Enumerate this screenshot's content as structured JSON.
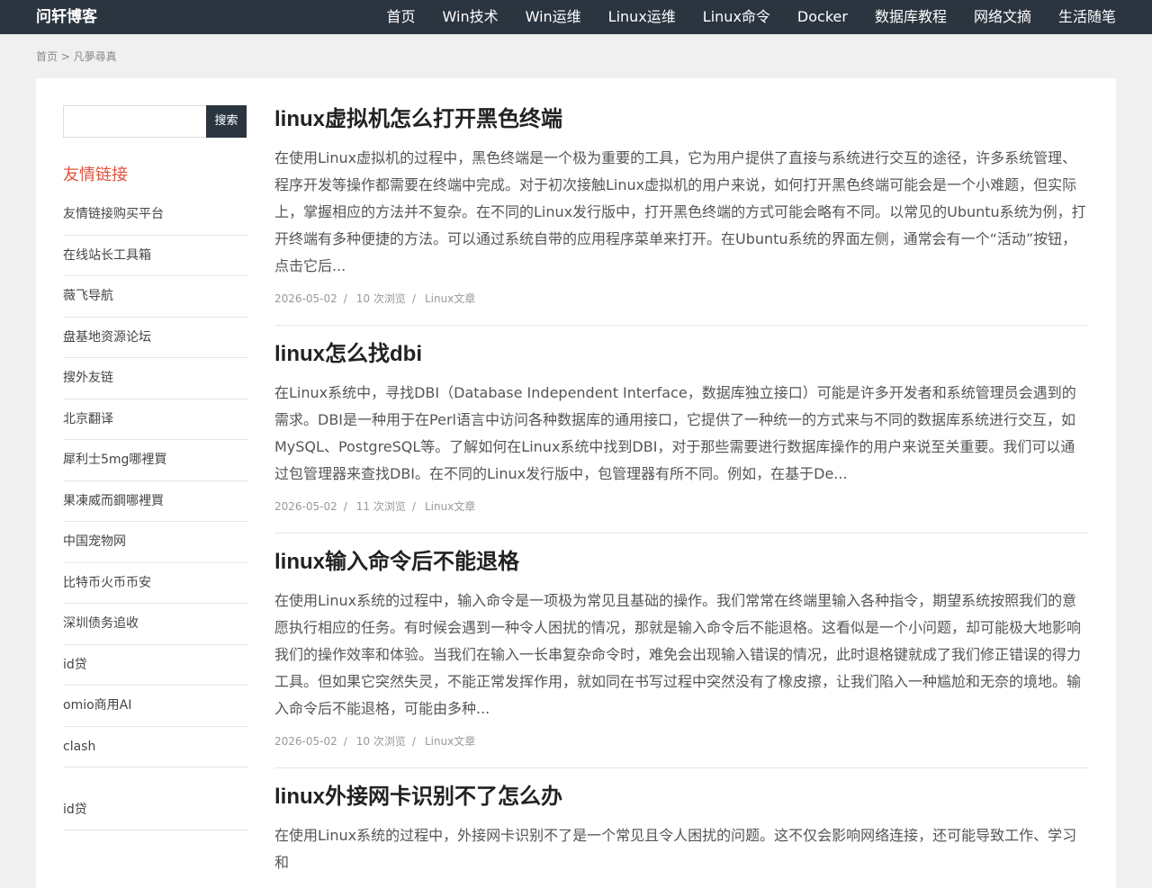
{
  "header": {
    "brand": "问轩博客",
    "nav": [
      "首页",
      "Win技术",
      "Win运维",
      "Linux运维",
      "Linux命令",
      "Docker",
      "数据库教程",
      "网络文摘",
      "生活随笔"
    ]
  },
  "breadcrumb": {
    "text": "首页 > 凡夢尋真"
  },
  "sidebar": {
    "search_button": "搜索",
    "links_title": "友情链接",
    "links": [
      "友情链接购买平台",
      "在线站长工具箱",
      "薇飞导航",
      "盘基地资源论坛",
      "搜外友链",
      "北京翻译",
      "犀利士5mg哪裡買",
      "果凍威而鋼哪裡買",
      "中国宠物网",
      "比特币火币币安",
      "深圳债务追收",
      "id贷",
      "omio商用AI",
      "clash",
      "id贷"
    ]
  },
  "posts": [
    {
      "title": "linux虚拟机怎么打开黑色终端",
      "excerpt": "在使用Linux虚拟机的过程中，黑色终端是一个极为重要的工具，它为用户提供了直接与系统进行交互的途径，许多系统管理、程序开发等操作都需要在终端中完成。对于初次接触Linux虚拟机的用户来说，如何打开黑色终端可能会是一个小难题，但实际上，掌握相应的方法并不复杂。在不同的Linux发行版中，打开黑色终端的方式可能会略有不同。以常见的Ubuntu系统为例，打开终端有多种便捷的方法。可以通过系统自带的应用程序菜单来打开。在Ubuntu系统的界面左侧，通常会有一个“活动”按钮，点击它后...",
      "date": "2026-05-02",
      "views": "10 次浏览",
      "category": "Linux文章"
    },
    {
      "title": "linux怎么找dbi",
      "excerpt": "在Linux系统中，寻找DBI（Database Independent Interface，数据库独立接口）可能是许多开发者和系统管理员会遇到的需求。DBI是一种用于在Perl语言中访问各种数据库的通用接口，它提供了一种统一的方式来与不同的数据库系统进行交互，如MySQL、PostgreSQL等。了解如何在Linux系统中找到DBI，对于那些需要进行数据库操作的用户来说至关重要。我们可以通过包管理器来查找DBI。在不同的Linux发行版中，包管理器有所不同。例如，在基于De...",
      "date": "2026-05-02",
      "views": "11 次浏览",
      "category": "Linux文章"
    },
    {
      "title": "linux输入命令后不能退格",
      "excerpt": "在使用Linux系统的过程中，输入命令是一项极为常见且基础的操作。我们常常在终端里输入各种指令，期望系统按照我们的意愿执行相应的任务。有时候会遇到一种令人困扰的情况，那就是输入命令后不能退格。这看似是一个小问题，却可能极大地影响我们的操作效率和体验。当我们在输入一长串复杂命令时，难免会出现输入错误的情况，此时退格键就成了我们修正错误的得力工具。但如果它突然失灵，不能正常发挥作用，就如同在书写过程中突然没有了橡皮擦，让我们陷入一种尴尬和无奈的境地。输入命令后不能退格，可能由多种...",
      "date": "2026-05-02",
      "views": "10 次浏览",
      "category": "Linux文章"
    },
    {
      "title": "linux外接网卡识别不了怎么办",
      "excerpt": "在使用Linux系统的过程中，外接网卡识别不了是一个常见且令人困扰的问题。这不仅会影响网络连接，还可能导致工作、学习和"
    }
  ]
}
